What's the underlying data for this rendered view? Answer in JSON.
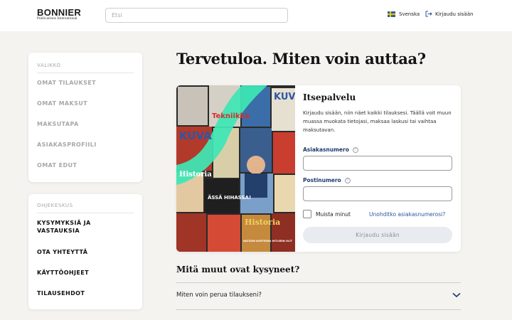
{
  "header": {
    "logo_main": "BONNIER",
    "logo_sub": "Publications International",
    "search_placeholder": "Etsi",
    "language": "Svenska",
    "login": "Kirjaudu sisään"
  },
  "menu": {
    "title": "VALIKKO",
    "items": [
      "OMAT TILAUKSET",
      "OMAT MAKSUT",
      "MAKSUTAPA",
      "ASIAKASPROFIILI",
      "OMAT EDUT"
    ]
  },
  "help": {
    "title": "OHJEKESKUS",
    "items": [
      "KYSYMYKSIÄ JA VASTAUKSIA",
      "OTA YHTEYTTÄ",
      "KÄYTTÖOHJEET",
      "TILAUSEHDOT"
    ]
  },
  "main": {
    "welcome": "Tervetuloa. Miten voin auttaa?",
    "self_service": {
      "title": "Itsepalvelu",
      "description": "Kirjaudu sisään, niin näet kaikki tilauksesi. Täällä voit muun muassa muokata tietojasi, maksaa laskusi tai vaihtaa maksutavan.",
      "customer_number_label": "Asiakasnumero",
      "postal_code_label": "Postinumero",
      "remember_label": "Muista minut",
      "forgot_link": "Unohditko asiakasnumerosi?",
      "submit_label": "Kirjaudu sisään"
    },
    "magazine_texts": {
      "kuva1": "KUVA",
      "tekniikka": "Tekniikka",
      "kuva2": "KUVA",
      "historia1": "Historia",
      "assa": "ÄSSÄ HIHASSA!",
      "historia2": "Historia",
      "hitler": "NATSIEN KOHTEENA HITLERIN OLIT"
    },
    "faq": {
      "title": "Mitä muut ovat kysyneet?",
      "questions": [
        "Miten voin perua tilaukseni?"
      ]
    }
  },
  "colors": {
    "accent_green": "#3ee6b5",
    "link_blue": "#2d55a0",
    "label_navy": "#1c3a6e"
  }
}
